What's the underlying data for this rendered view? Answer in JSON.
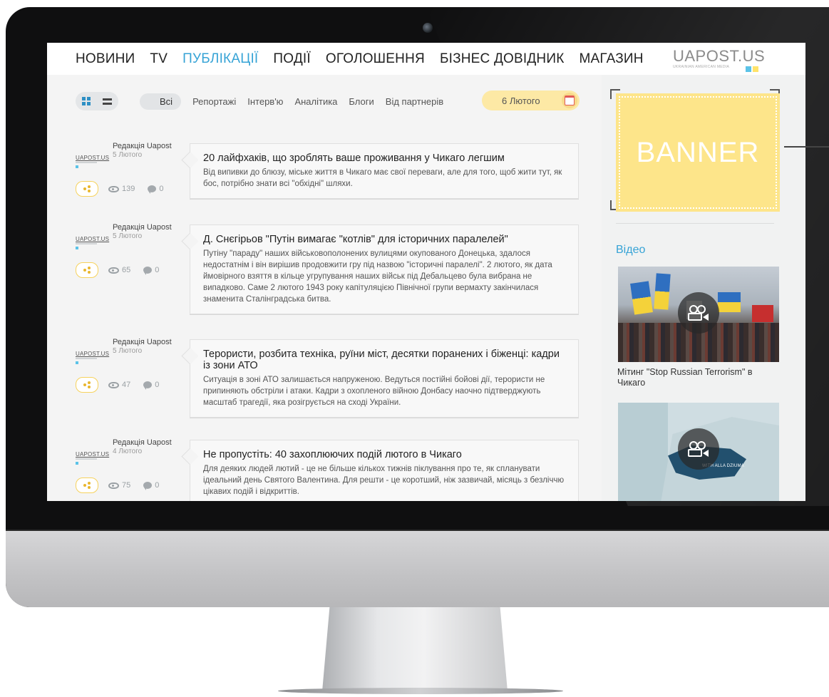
{
  "nav": {
    "items": [
      "НОВИНИ",
      "TV",
      "ПУБЛІКАЦІЇ",
      "ПОДІЇ",
      "ОГОЛОШЕННЯ",
      "БІЗНЕС ДОВІДНИК",
      "МАГАЗИН"
    ],
    "active_index": 2,
    "logo_main": "UAPOST.US",
    "logo_sub": "UKRAINIAN AMERICAN MEDIA"
  },
  "filters": {
    "categories": [
      "Всі",
      "Репортажі",
      "Інтерв'ю",
      "Аналітика",
      "Блоги",
      "Від партнерів"
    ],
    "active_index": 0,
    "date": "6 Лютого"
  },
  "articles": [
    {
      "author": "Редакція Uapost",
      "date": "5 Лютого",
      "views": "139",
      "comments": "0",
      "title": "20 лайфхаків, що зроблять ваше проживання у Чикаго легшим",
      "text": "Від випивки до блюзу, міське життя в Чикаго має свої переваги, але для того, щоб жити тут, як бос, потрібно знати всі \"обхідні\" шляхи."
    },
    {
      "author": "Редакція Uapost",
      "date": "5 Лютого",
      "views": "65",
      "comments": "0",
      "title": "Д. Снєгірьов \"Путін вимагає \"котлів\" для історичних паралелей\"",
      "text": "Путіну \"параду\" наших військовополонених вулицями окупованого Донецька, здалося недостатнім і він вирішив продовжити гру під назвою \"історичні паралелі\". 2 лютого, як дата ймовірного взяття в кільце угрупування наших військ під Дебальцево була вибрана не випадково. Саме 2 лютого 1943 року капітуляцією Північної групи вермахту закінчилася знаменита Сталінградська битва."
    },
    {
      "author": "Редакція Uapost",
      "date": "5 Лютого",
      "views": "47",
      "comments": "0",
      "title": "Терористи, розбита техніка, руїни міст, десятки поранених і біженці: кадри із зони АТО",
      "text": "Ситуація в зоні АТО залишається напруженою. Ведуться постійні бойові дії, терористи не припиняють обстріли і атаки. Кадри з охопленого війною Донбасу наочно підтверджують масштаб трагедії, яка розігрується на сході України."
    },
    {
      "author": "Редакція Uapost",
      "date": "4 Лютого",
      "views": "75",
      "comments": "0",
      "title": "Не пропустіть: 40 захоплюючих подій лютого в Чикаго",
      "text": "Для деяких людей лютий - це не більше кількох тижнів піклування про те, як спланувати ідеальний день Святого Валентина. Для решти - це коротший, ніж зазвичай, місяць з безліччю цікавих подій і відкриттів."
    }
  ],
  "mini_logo": "UAPOST.US",
  "sidebar": {
    "banner_text": "BANNER",
    "video_heading": "Відео",
    "videos": [
      {
        "caption": "Мітинг \"Stop Russian Terrorism\" в Чикаго"
      },
      {
        "caption": "",
        "overlay": "WITH ALLA DZIUMA"
      }
    ]
  },
  "colors": {
    "accent": "#36a3d6",
    "banner": "#fde58a",
    "date_pill": "#fde9a5",
    "share_border": "#f6d25c"
  }
}
